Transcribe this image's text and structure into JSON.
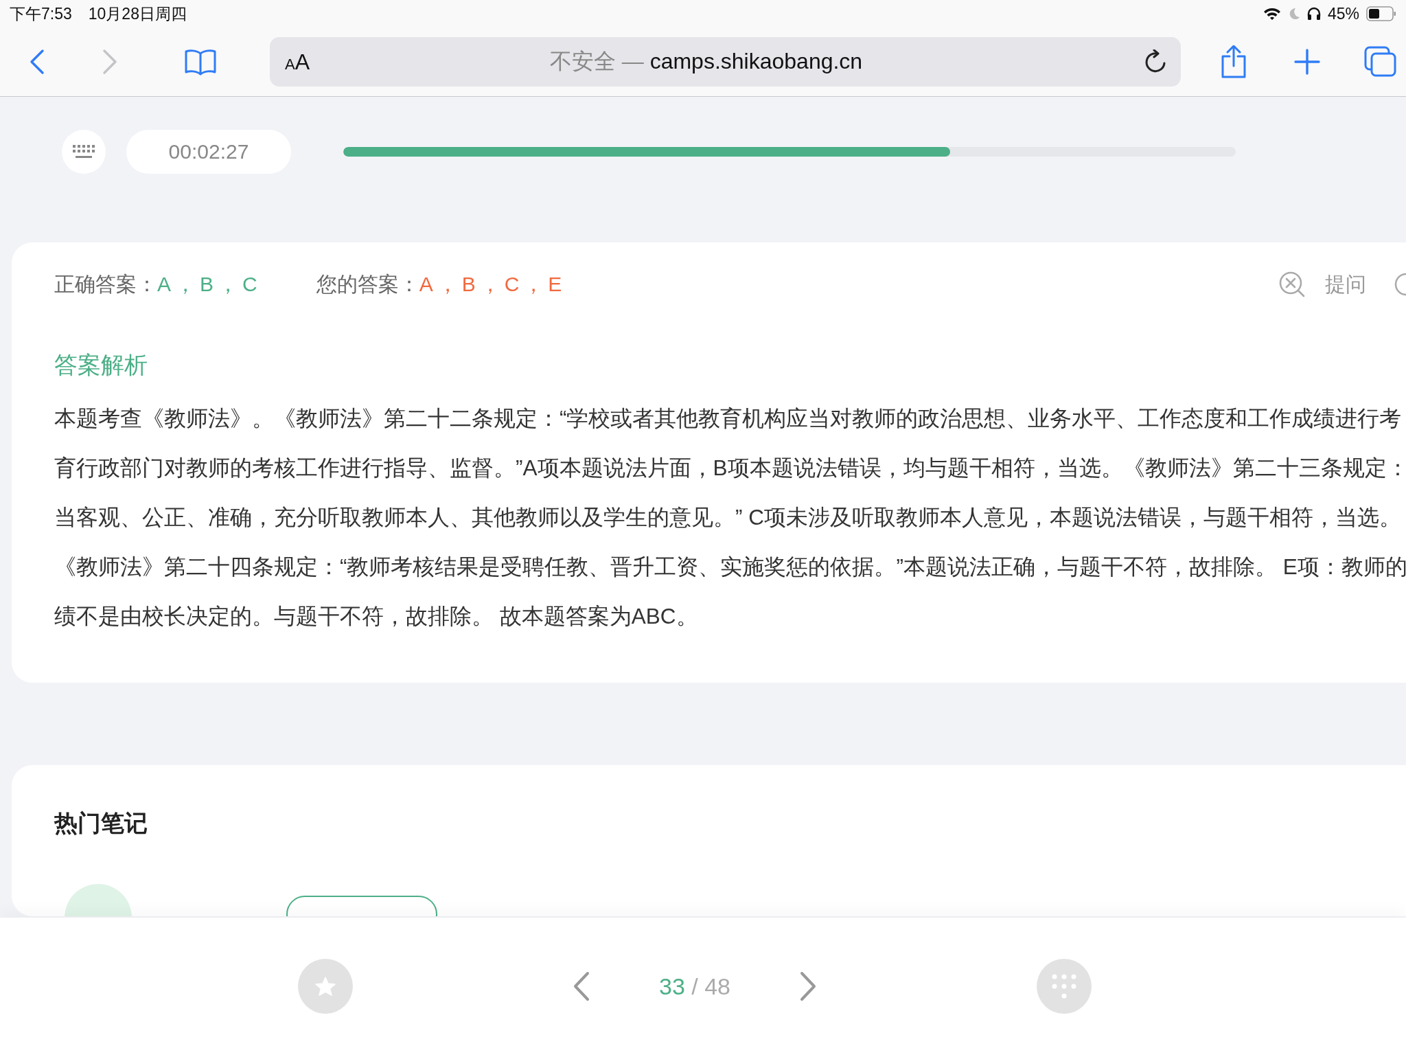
{
  "status_bar": {
    "time": "下午7:53",
    "date": "10月28日周四",
    "battery": "45%"
  },
  "browser": {
    "text_size_letters": [
      "A",
      "A"
    ],
    "security": "不安全 —",
    "host": "camps.shikaobang.cn"
  },
  "quiz": {
    "timer": "00:02:27",
    "progress": {
      "level": 0.68
    }
  },
  "answer": {
    "correct_label": "正确答案：",
    "correct": "A，B，C",
    "yours_label": "您的答案：",
    "yours": "A，B，C，E",
    "ask": "提问"
  },
  "explanation": {
    "title": "答案解析",
    "lines": [
      "本题考查《教师法》。《教师法》第二十二条规定：“学校或者其他教育机构应当对教师的政治思想、业务水平、工作态度和工作成绩进行考",
      "育行政部门对教师的考核工作进行指导、监督。”A项本题说法片面，B项本题说法错误，均与题干相符，当选。《教师法》第二十三条规定：",
      "当客观、公正、准确，充分听取教师本人、其他教师以及学生的意见。” C项未涉及听取教师本人意见，本题说法错误，与题干相符，当选。",
      "《教师法》第二十四条规定：“教师考核结果是受聘任教、晋升工资、实施奖惩的依据。”本题说法正确，与题干不符，故排除。 E项：教师的",
      "绩不是由校长决定的。与题干不符，故排除。 故本题答案为ABC。"
    ]
  },
  "notes": {
    "title": "热门笔记"
  },
  "pager": {
    "current": "33",
    "total": "/ 48"
  }
}
